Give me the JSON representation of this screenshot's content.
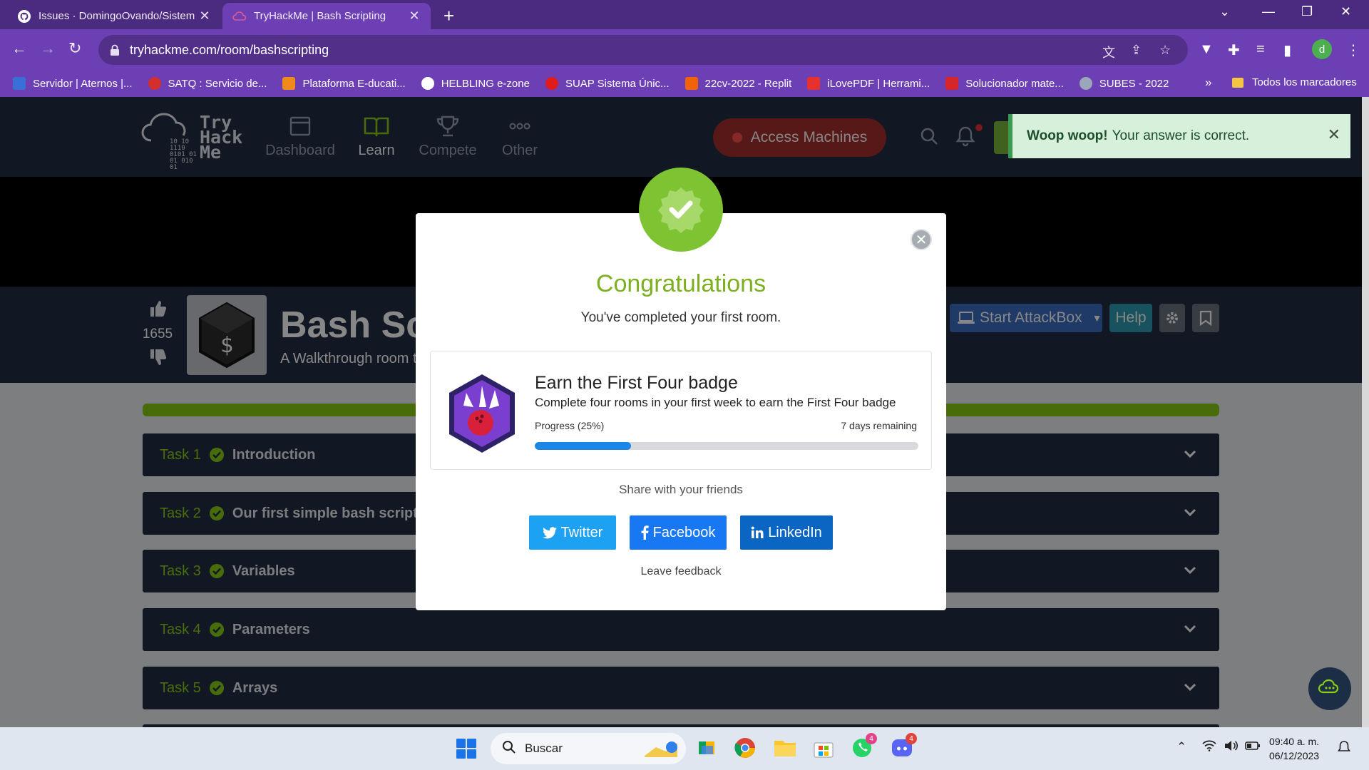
{
  "browser": {
    "tabs": [
      {
        "title": "Issues · DomingoOvando/Sistem",
        "active": false,
        "icon": "github-icon"
      },
      {
        "title": "TryHackMe | Bash Scripting",
        "active": true,
        "icon": "tryhackme-icon"
      }
    ],
    "url": "tryhackme.com/room/bashscripting",
    "profile_initial": "d",
    "bookmarks": [
      {
        "label": "Servidor | Aternos |...",
        "color": "#3b6fd8"
      },
      {
        "label": "SATQ : Servicio de...",
        "color": "#d32f2f"
      },
      {
        "label": "Plataforma E-ducati...",
        "color": "#f08a1c"
      },
      {
        "label": "HELBLING e-zone",
        "color": "#ffffff"
      },
      {
        "label": "SUAP Sistema Únic...",
        "color": "#e01b1b"
      },
      {
        "label": "22cv-2022 - Replit",
        "color": "#f26207"
      },
      {
        "label": "iLovePDF | Herrami...",
        "color": "#e5322d"
      },
      {
        "label": "Solucionador mate...",
        "color": "#d7262a"
      },
      {
        "label": "SUBES - 2022",
        "color": "#9aa7b8"
      }
    ],
    "bookmarks_more": "»",
    "all_bookmarks": "Todos los marcadores"
  },
  "nav": {
    "logo_text": [
      "Try",
      "Hack",
      "Me"
    ],
    "logo_bits": [
      "10  10",
      "1110",
      "0101 01",
      "01   010",
      "     01"
    ],
    "items": [
      {
        "label": "Dashboard",
        "icon": "dashboard-icon",
        "active": false
      },
      {
        "label": "Learn",
        "icon": "book-icon",
        "active": true
      },
      {
        "label": "Compete",
        "icon": "trophy-icon",
        "active": false
      },
      {
        "label": "Other",
        "icon": "more-icon",
        "active": false
      }
    ],
    "access_machines": "Access Machines"
  },
  "toast": {
    "bold": "Woop woop!",
    "text": "Your answer is correct."
  },
  "room": {
    "votes": "1655",
    "title": "Bash Scripting",
    "subtitle": "A Walkthrough room to teach you the basics of bash scripting",
    "start_attackbox": "Start AttackBox",
    "help": "Help"
  },
  "tasks": [
    {
      "num": "Task 1",
      "name": "Introduction"
    },
    {
      "num": "Task 2",
      "name": "Our first simple bash scripts"
    },
    {
      "num": "Task 3",
      "name": "Variables"
    },
    {
      "num": "Task 4",
      "name": "Parameters"
    },
    {
      "num": "Task 5",
      "name": "Arrays"
    }
  ],
  "modal": {
    "title": "Congratulations",
    "subtitle": "You've completed your first room.",
    "badge_title": "Earn the First Four badge",
    "badge_desc": "Complete four rooms in your first week to earn the First Four badge",
    "progress_label": "Progress (25%)",
    "progress_value": 0.25,
    "remaining": "7 days remaining",
    "share_label": "Share with your friends",
    "twitter": "Twitter",
    "facebook": "Facebook",
    "linkedin": "LinkedIn",
    "feedback": "Leave feedback"
  },
  "taskbar": {
    "search": "Buscar",
    "whatsapp_badge": "4",
    "discord_badge": "4",
    "time": "09:40 a. m.",
    "date": "06/12/2023"
  },
  "colors": {
    "chrome_purple": "#6d3fb4",
    "thm_navy": "#212c42",
    "thm_green": "#88cc14",
    "congrats_green": "#7cb020",
    "progress_blue": "#1b86e6"
  }
}
